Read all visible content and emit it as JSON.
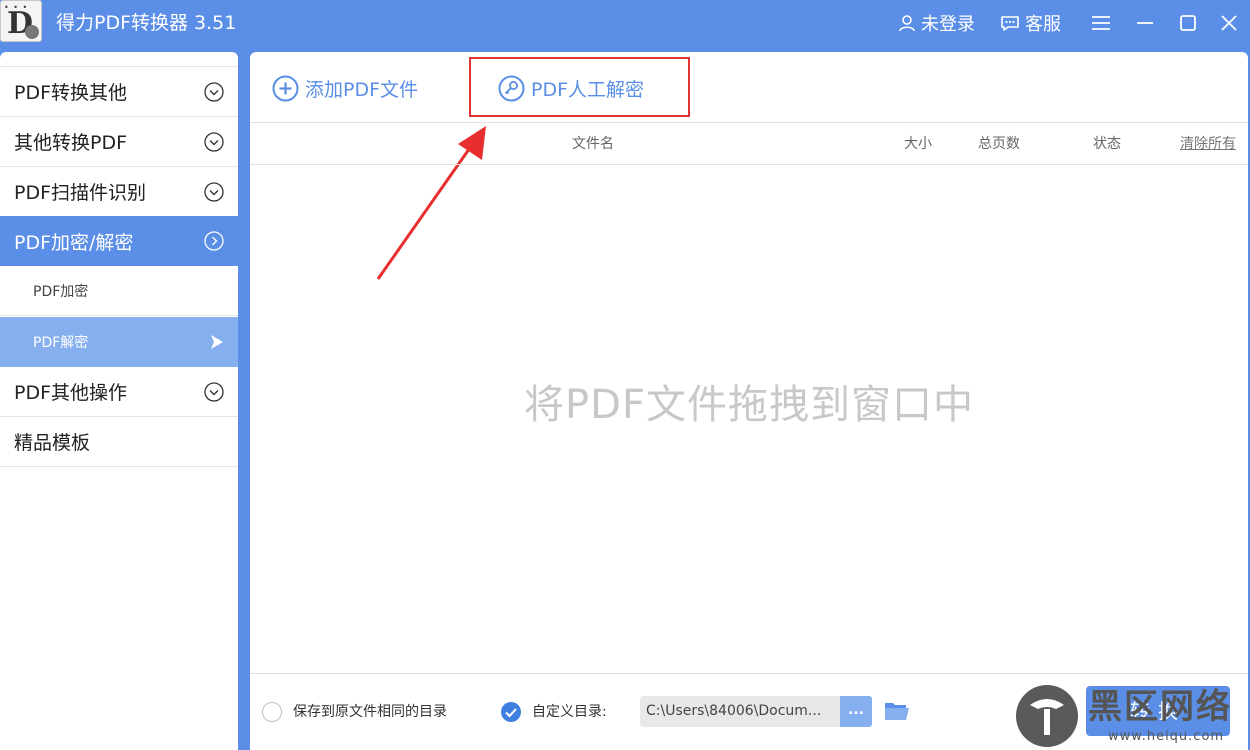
{
  "app": {
    "title": "得力PDF转换器 3.51",
    "logo_dots": "• • •",
    "logo_letter": "D"
  },
  "titlebar": {
    "login_label": "未登录",
    "service_label": "客服"
  },
  "sidebar": {
    "items": [
      {
        "label": "PDF转换其他"
      },
      {
        "label": "其他转换PDF"
      },
      {
        "label": "PDF扫描件识别"
      },
      {
        "label": "PDF加密/解密"
      },
      {
        "label": "PDF加密"
      },
      {
        "label": "PDF解密"
      },
      {
        "label": "PDF其他操作"
      },
      {
        "label": "精品模板"
      }
    ]
  },
  "toolbar": {
    "add_label": "添加PDF文件",
    "decrypt_label": "PDF人工解密"
  },
  "table": {
    "columns": [
      "文件名",
      "大小",
      "总页数",
      "状态"
    ],
    "clear_label": "清除所有"
  },
  "drop_hint": "将PDF文件拖拽到窗口中",
  "footer": {
    "same_dir_label": "保存到原文件相同的目录",
    "custom_dir_label": "自定义目录:",
    "path_value": "C:\\Users\\84006\\Docum...",
    "browse_label": "...",
    "convert_label": "转换"
  },
  "watermark": {
    "text": "黑区网络",
    "url": "www.heiqu.com"
  },
  "colors": {
    "accent": "#5b8ee6",
    "accent_light": "#86aff0",
    "highlight": "#e03434"
  }
}
